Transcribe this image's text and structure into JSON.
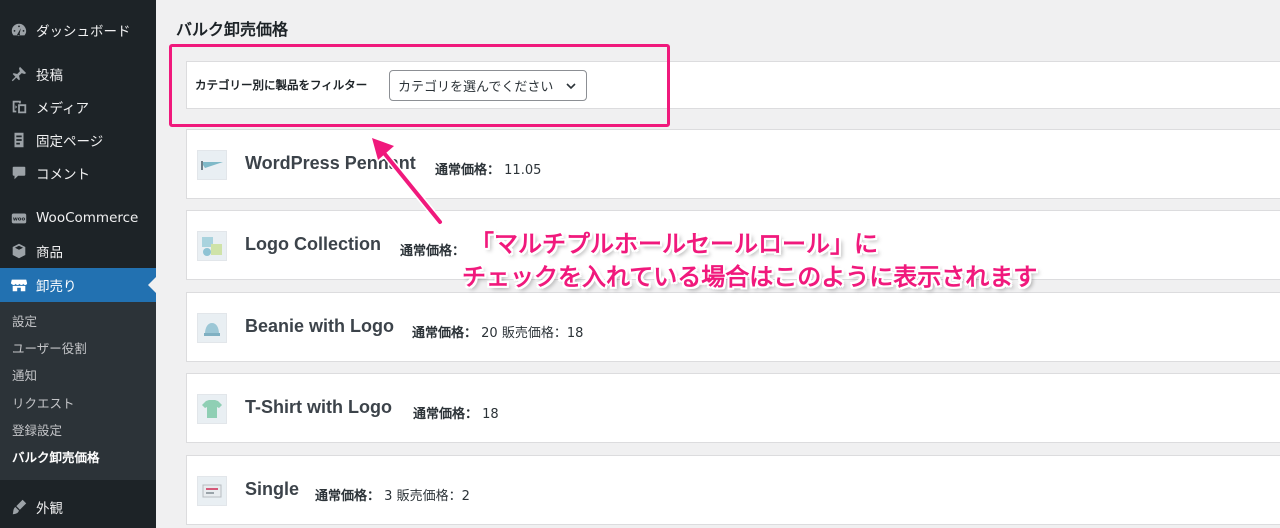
{
  "sidebar": {
    "items": [
      {
        "label": "ダッシュボード",
        "icon": "dashboard-icon"
      },
      {
        "label": "投稿",
        "icon": "pin-icon"
      },
      {
        "label": "メディア",
        "icon": "media-icon"
      },
      {
        "label": "固定ページ",
        "icon": "page-icon"
      },
      {
        "label": "コメント",
        "icon": "comment-icon"
      },
      {
        "label": "WooCommerce",
        "icon": "woo-icon"
      },
      {
        "label": "商品",
        "icon": "product-box-icon"
      },
      {
        "label": "卸売り",
        "icon": "store-icon"
      },
      {
        "label": "外観",
        "icon": "brush-icon"
      }
    ],
    "submenu": [
      "設定",
      "ユーザー役割",
      "通知",
      "リクエスト",
      "登録設定",
      "バルク卸売価格"
    ]
  },
  "page": {
    "title": "バルク卸売価格",
    "filter_label": "カテゴリー別に製品をフィルター",
    "filter_select_value": "カテゴリを選んでください"
  },
  "products": [
    {
      "name": "WordPress Pennant",
      "regular_label": "通常価格：",
      "regular": "11.05",
      "sale_label": "",
      "sale": ""
    },
    {
      "name": "Logo Collection",
      "regular_label": "通常価格：",
      "regular": "",
      "sale_label": "",
      "sale": ""
    },
    {
      "name": "Beanie with Logo",
      "regular_label": "通常価格：",
      "regular": "20",
      "sale_label": "販売価格：",
      "sale": "18"
    },
    {
      "name": "T-Shirt with Logo",
      "regular_label": "通常価格：",
      "regular": "18",
      "sale_label": "",
      "sale": ""
    },
    {
      "name": "Single",
      "regular_label": "通常価格：",
      "regular": "3",
      "sale_label": "販売価格：",
      "sale": "2"
    }
  ],
  "annotation": {
    "line1": "「マルチプルホールセールロール」に",
    "line2": "チェックを入れている場合はこのように表示されます"
  },
  "colors": {
    "sidebar_bg": "#1d2327",
    "active_menu": "#2271b1",
    "annotation": "#f0197c"
  }
}
